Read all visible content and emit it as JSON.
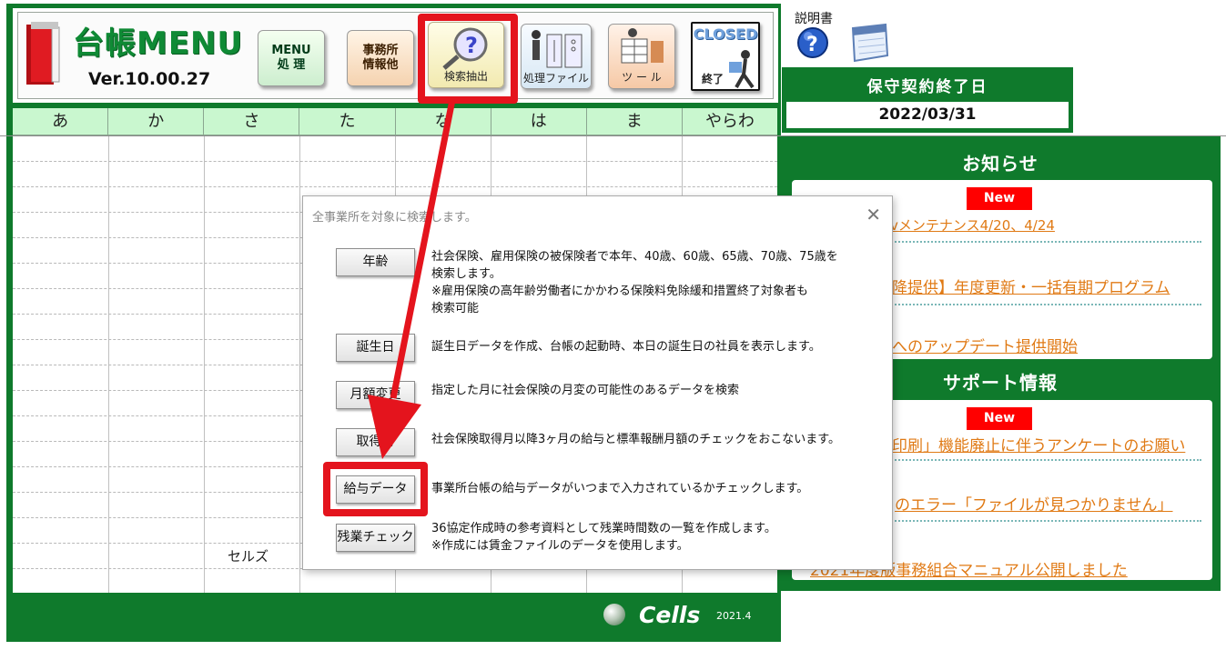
{
  "header": {
    "app_title": "台帳MENU",
    "version": "Ver.10.00.27",
    "buttons": {
      "menu": "MENU\n処 理",
      "office": "事務所\n情報他",
      "search": "検索抽出",
      "files": "処理ファイル",
      "tools": "ツ ー ル",
      "close_top": "CLOSED",
      "close_bottom": "終了"
    }
  },
  "kana_tabs": [
    "あ",
    "か",
    "さ",
    "た",
    "な",
    "は",
    "ま",
    "やらわ"
  ],
  "grid_cell_text": "セルズ",
  "footer": {
    "brand": "Cells",
    "version": "2021.4"
  },
  "right": {
    "manual_label": "説明書",
    "contract_title": "保守契約終了日",
    "contract_date": "2022/03/31",
    "news_title": "お知らせ",
    "support_title": "サポート情報",
    "new_badge": "New",
    "news_items": [
      "vメンテナンス4/20、4/24",
      "降提供】年度更新・一括有期プログラム",
      "へのアップデート提供開始"
    ],
    "support_items": [
      "印刷」機能廃止に伴うアンケートのお願い",
      "のエラー「ファイルが見つかりません」",
      "2021年度版事務組合マニュアル公開しました"
    ]
  },
  "dialog": {
    "title": "全事業所を対象に検索します。",
    "options": [
      {
        "button": "年齢",
        "desc": "社会保険、雇用保険の被保険者で本年、40歳、60歳、65歳、70歳、75歳を\n検索します。\n※雇用保険の高年齢労働者にかかわる保険料免除緩和措置終了対象者も\n検索可能"
      },
      {
        "button": "誕生日",
        "desc": "誕生日データを作成、台帳の起動時、本日の誕生日の社員を表示します。"
      },
      {
        "button": "月額変更",
        "desc": "指定した月に社会保険の月変の可能性のあるデータを検索"
      },
      {
        "button": "取得時",
        "desc": "社会保険取得月以降3ヶ月の給与と標準報酬月額のチェックをおこないます。"
      },
      {
        "button": "給与データ",
        "desc": "事業所台帳の給与データがいつまで入力されているかチェックします。"
      },
      {
        "button": "残業チェック",
        "desc": "36協定作成時の参考資料として残業時間数の一覧を作成します。\n※作成には賃金ファイルのデータを使用します。"
      }
    ]
  },
  "colors": {
    "brand_green": "#0f7a2c",
    "highlight_red": "#e4141d",
    "link_orange": "#e07a15",
    "kana_tab_bg": "#c9f7cf"
  }
}
